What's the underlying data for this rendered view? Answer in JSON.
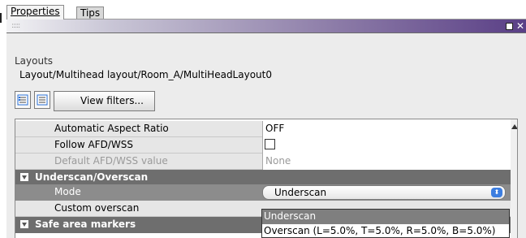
{
  "tabs": {
    "properties": "Properties",
    "tips": "Tips"
  },
  "header": {
    "section": "Layouts",
    "path": "Layout/Multihead layout/Room_A/MultiHeadLayout0"
  },
  "toolbar": {
    "view_filters": "View filters..."
  },
  "properties": [
    {
      "label": "Automatic Aspect Ratio",
      "value": "OFF"
    },
    {
      "label": "Follow AFD/WSS",
      "value": ""
    },
    {
      "label": "Default AFD/WSS value",
      "value": "None"
    },
    {
      "label": "Underscan/Overscan"
    },
    {
      "label": "Mode",
      "value": "Underscan"
    },
    {
      "label": "Custom overscan",
      "value": ""
    },
    {
      "label": "Safe area markers"
    }
  ],
  "dropdown": {
    "options": [
      "Underscan",
      "Overscan (L=5.0%, T=5.0%, R=5.0%, B=5.0%)"
    ],
    "selected": "Underscan"
  },
  "icons": [
    "grip-icon",
    "restore-icon",
    "close-icon",
    "categorized-view-icon",
    "list-view-icon",
    "collapse-icon",
    "scroll-up-icon"
  ]
}
